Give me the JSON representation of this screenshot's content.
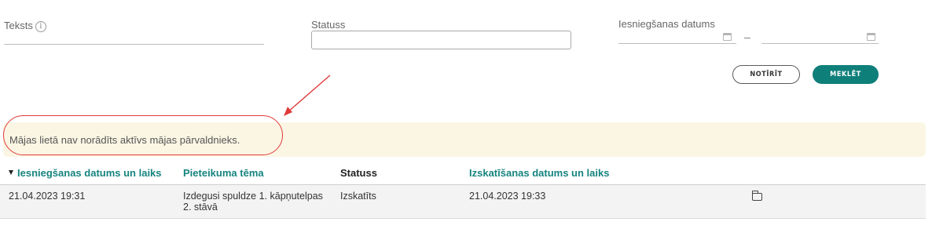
{
  "filters": {
    "text_label": "Teksts",
    "info_glyph": "i",
    "status_label": "Statuss",
    "date_label": "Iesniegšanas datums",
    "date_range_separator": "–"
  },
  "buttons": {
    "clear": "NOTĪRĪT",
    "search": "MEKLĒT"
  },
  "notice": {
    "text": "Mājas lietā nav norādīts aktīvs mājas pārvaldnieks."
  },
  "table": {
    "headers": [
      "Iesniegšanas datums un laiks",
      "Pieteikuma tēma",
      "Statuss",
      "Izskatīšanas datums un laiks"
    ],
    "sorted_column": 0,
    "sort_direction": "descending",
    "rows": [
      {
        "submitted": "21.04.2023 19:31",
        "topic": "Izdegusi spuldze 1. kāpņutelpas 2. stāvā",
        "status": "Izskatīts",
        "reviewed": "21.04.2023 19:33",
        "action_icon": "folder-icon"
      }
    ]
  },
  "colors": {
    "accent": "#16847f",
    "primary_button": "#0f7f7a",
    "notice_background": "#fbf6e4",
    "annotation_red": "#e03b3b"
  },
  "icons": [
    "info-icon",
    "calendar-icon",
    "sort-descending-icon",
    "folder-icon"
  ]
}
